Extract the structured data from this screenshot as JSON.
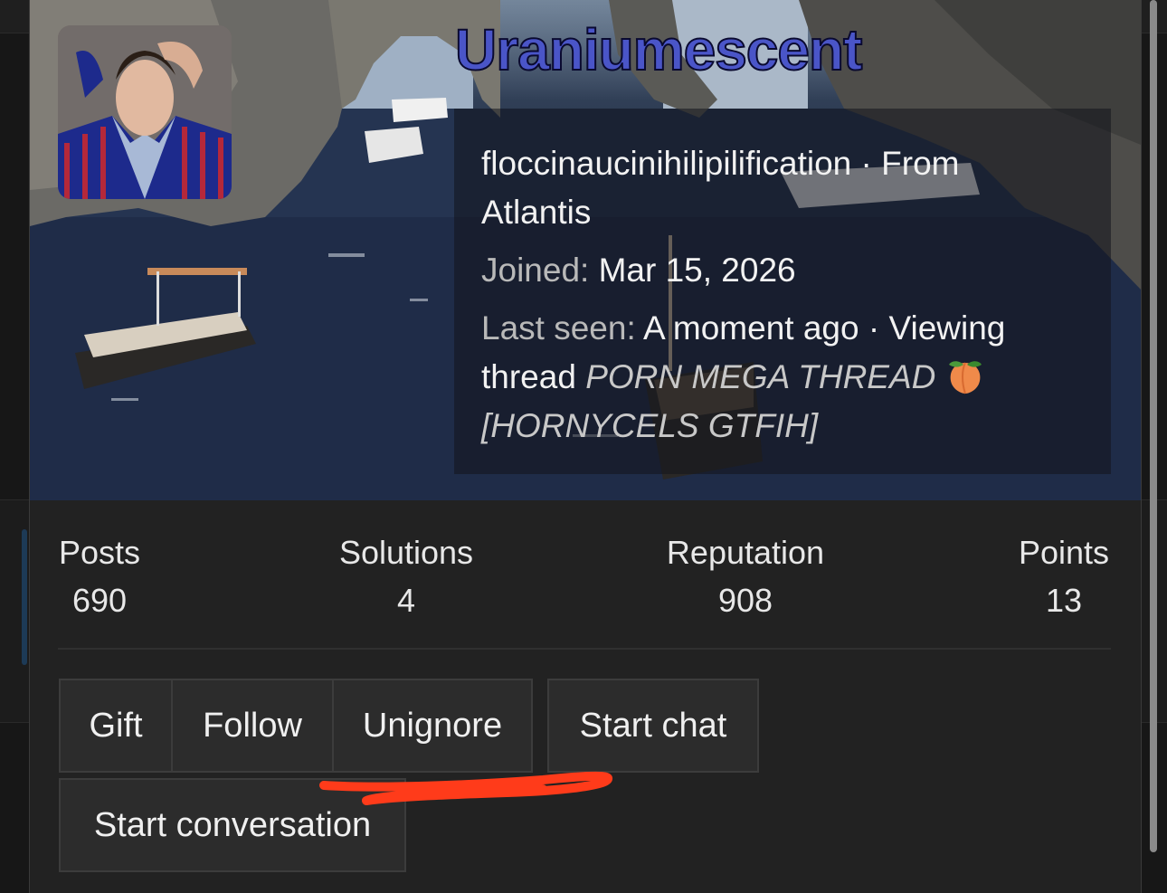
{
  "profile": {
    "username": "Uraniumescent",
    "title": "floccinaucinihilipilification",
    "separator": " · ",
    "location_prefix": "From",
    "location": "Atlantis",
    "joined_label": "Joined:",
    "joined_value": "Mar 15, 2026",
    "last_seen_label": "Last seen:",
    "last_seen_value": "A moment ago",
    "activity_label": "Viewing thread",
    "thread_title": "PORN MEGA THREAD",
    "thread_tag": "[HORNYCELS GTFIH]",
    "peach_icon": "peach-emoji"
  },
  "stats": [
    {
      "label": "Posts",
      "value": "690"
    },
    {
      "label": "Solutions",
      "value": "4"
    },
    {
      "label": "Reputation",
      "value": "908"
    },
    {
      "label": "Points",
      "value": "13"
    }
  ],
  "actions": {
    "gift": "Gift",
    "follow": "Follow",
    "unignore": "Unignore",
    "start_chat": "Start chat",
    "start_conversation": "Start conversation"
  },
  "colors": {
    "username": "#4a55c8",
    "annotation": "#ff3b1a"
  }
}
